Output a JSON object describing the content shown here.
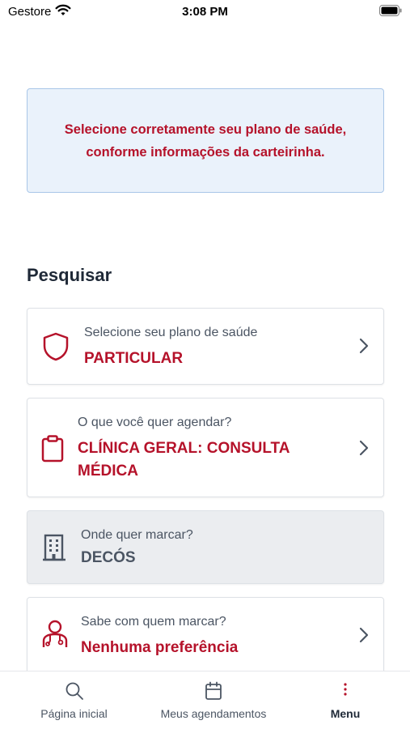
{
  "status_bar": {
    "carrier": "Gestore",
    "time": "3:08 PM"
  },
  "notice": {
    "text": "Selecione corretamente seu plano de saúde,\nconforme informações da carteirinha."
  },
  "search": {
    "title": "Pesquisar",
    "cards": [
      {
        "label": "Selecione seu plano de saúde",
        "value": "PARTICULAR",
        "icon": "shield-icon",
        "enabled": true
      },
      {
        "label": "O que você quer agendar?",
        "value": "CLÍNICA GERAL: CONSULTA MÉDICA",
        "icon": "clipboard-icon",
        "enabled": true
      },
      {
        "label": "Onde quer marcar?",
        "value": "DECÓS",
        "icon": "building-icon",
        "enabled": false
      },
      {
        "label": "Sabe com quem marcar?",
        "value": "Nenhuma preferência",
        "icon": "doctor-icon",
        "enabled": true
      }
    ]
  },
  "tab_bar": {
    "tabs": [
      {
        "label": "Página inicial",
        "icon": "search-icon"
      },
      {
        "label": "Meus agendamentos",
        "icon": "calendar-icon"
      },
      {
        "label": "Menu",
        "icon": "more-vertical-icon",
        "active": true
      }
    ]
  },
  "colors": {
    "accent": "#b5122a",
    "notice_bg": "#eaf2fb",
    "notice_border": "#a9c6e8",
    "disabled_bg": "#ebedf0"
  }
}
